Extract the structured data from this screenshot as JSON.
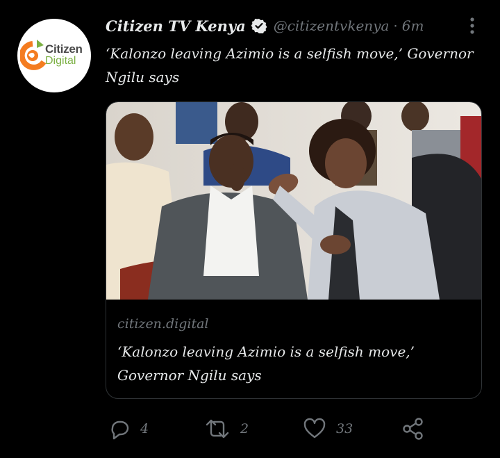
{
  "account": {
    "display_name": "Citizen TV Kenya",
    "handle": "@citizentvkenya",
    "separator": "·",
    "time_ago": "6m",
    "avatar_logo": {
      "line1": "Citizen",
      "line2": "Digital"
    }
  },
  "tweet": {
    "text": "‘Kalonzo leaving Azimio is a selfish move,’ Governor Ngilu says"
  },
  "card": {
    "domain": "citizen.digital",
    "title": "‘Kalonzo leaving Azimio is a selfish move,’ Governor Ngilu says"
  },
  "actions": {
    "replies": "4",
    "retweets": "2",
    "likes": "33"
  },
  "colors": {
    "background": "#000000",
    "text": "#e7e9ea",
    "muted": "#71767b",
    "border": "#2f3336",
    "logo_orange": "#f47c20",
    "logo_green": "#7bb043"
  },
  "icons": [
    "verified-badge-icon",
    "more-options-icon",
    "reply-icon",
    "retweet-icon",
    "like-icon",
    "share-icon"
  ]
}
